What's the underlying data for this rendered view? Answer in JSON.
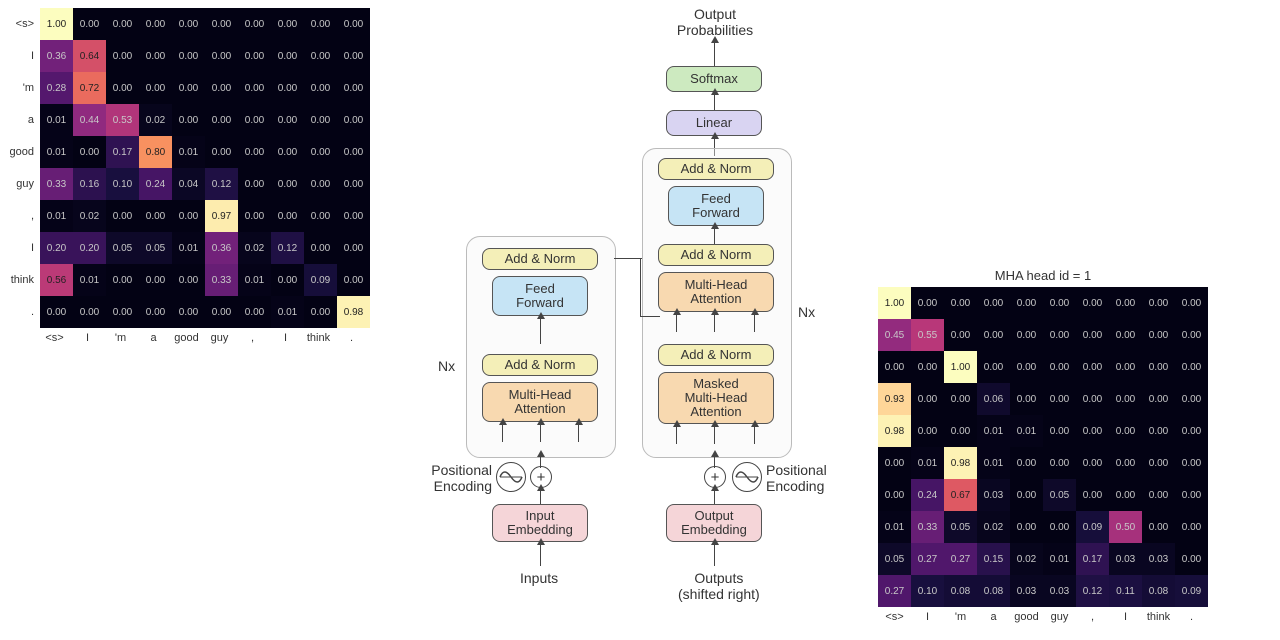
{
  "tokens": [
    "<s>",
    "I",
    "'m",
    "a",
    "good",
    "guy",
    ",",
    "I",
    "think",
    "."
  ],
  "chart_data": [
    {
      "type": "heatmap",
      "id": "attention-head-0",
      "title": "",
      "x_labels": [
        "<s>",
        "I",
        "'m",
        "a",
        "good",
        "guy",
        ",",
        "I",
        "think",
        "."
      ],
      "y_labels": [
        "<s>",
        "I",
        "'m",
        "a",
        "good",
        "guy",
        ",",
        "I",
        "think",
        "."
      ],
      "values": [
        [
          1.0,
          0.0,
          0.0,
          0.0,
          0.0,
          0.0,
          0.0,
          0.0,
          0.0,
          0.0
        ],
        [
          0.36,
          0.64,
          0.0,
          0.0,
          0.0,
          0.0,
          0.0,
          0.0,
          0.0,
          0.0
        ],
        [
          0.28,
          0.72,
          0.0,
          0.0,
          0.0,
          0.0,
          0.0,
          0.0,
          0.0,
          0.0
        ],
        [
          0.01,
          0.44,
          0.53,
          0.02,
          0.0,
          0.0,
          0.0,
          0.0,
          0.0,
          0.0
        ],
        [
          0.01,
          0.0,
          0.17,
          0.8,
          0.01,
          0.0,
          0.0,
          0.0,
          0.0,
          0.0
        ],
        [
          0.33,
          0.16,
          0.1,
          0.24,
          0.04,
          0.12,
          0.0,
          0.0,
          0.0,
          0.0
        ],
        [
          0.01,
          0.02,
          0.0,
          0.0,
          0.0,
          0.97,
          0.0,
          0.0,
          0.0,
          0.0
        ],
        [
          0.2,
          0.2,
          0.05,
          0.05,
          0.01,
          0.36,
          0.02,
          0.12,
          0.0,
          0.0
        ],
        [
          0.56,
          0.01,
          0.0,
          0.0,
          0.0,
          0.33,
          0.01,
          0.0,
          0.09,
          0.0
        ],
        [
          0.0,
          0.0,
          0.0,
          0.0,
          0.0,
          0.0,
          0.0,
          0.01,
          0.0,
          0.98
        ]
      ]
    },
    {
      "type": "heatmap",
      "id": "attention-head-1",
      "title": "MHA head id = 1",
      "x_labels": [
        "<s>",
        "I",
        "'m",
        "a",
        "good",
        "guy",
        ",",
        "I",
        "think",
        "."
      ],
      "y_labels": [
        "<s>",
        "I",
        "'m",
        "a",
        "good",
        "guy",
        ",",
        "I",
        "think",
        "."
      ],
      "values": [
        [
          1.0,
          0.0,
          0.0,
          0.0,
          0.0,
          0.0,
          0.0,
          0.0,
          0.0,
          0.0
        ],
        [
          0.45,
          0.55,
          0.0,
          0.0,
          0.0,
          0.0,
          0.0,
          0.0,
          0.0,
          0.0
        ],
        [
          0.0,
          0.0,
          1.0,
          0.0,
          0.0,
          0.0,
          0.0,
          0.0,
          0.0,
          0.0
        ],
        [
          0.93,
          0.0,
          0.0,
          0.06,
          0.0,
          0.0,
          0.0,
          0.0,
          0.0,
          0.0
        ],
        [
          0.98,
          0.0,
          0.0,
          0.01,
          0.01,
          0.0,
          0.0,
          0.0,
          0.0,
          0.0
        ],
        [
          0.0,
          0.01,
          0.98,
          0.01,
          0.0,
          0.0,
          0.0,
          0.0,
          0.0,
          0.0
        ],
        [
          0.0,
          0.24,
          0.67,
          0.03,
          0.0,
          0.05,
          0.0,
          0.0,
          0.0,
          0.0
        ],
        [
          0.01,
          0.33,
          0.05,
          0.02,
          0.0,
          0.0,
          0.09,
          0.5,
          0.0,
          0.0
        ],
        [
          0.05,
          0.27,
          0.27,
          0.15,
          0.02,
          0.01,
          0.17,
          0.03,
          0.03,
          0.0
        ],
        [
          0.27,
          0.1,
          0.08,
          0.08,
          0.03,
          0.03,
          0.12,
          0.11,
          0.08,
          0.09
        ]
      ]
    }
  ],
  "diagram": {
    "top_label": "Output\nProbabilities",
    "softmax": "Softmax",
    "linear": "Linear",
    "addnorm": "Add & Norm",
    "feedforward": "Feed\nForward",
    "mha": "Multi-Head\nAttention",
    "masked_mha": "Masked\nMulti-Head\nAttention",
    "input_emb": "Input\nEmbedding",
    "output_emb": "Output\nEmbedding",
    "pos_enc": "Positional\nEncoding",
    "inputs": "Inputs",
    "outputs": "Outputs\n(shifted right)",
    "nx": "Nx"
  }
}
